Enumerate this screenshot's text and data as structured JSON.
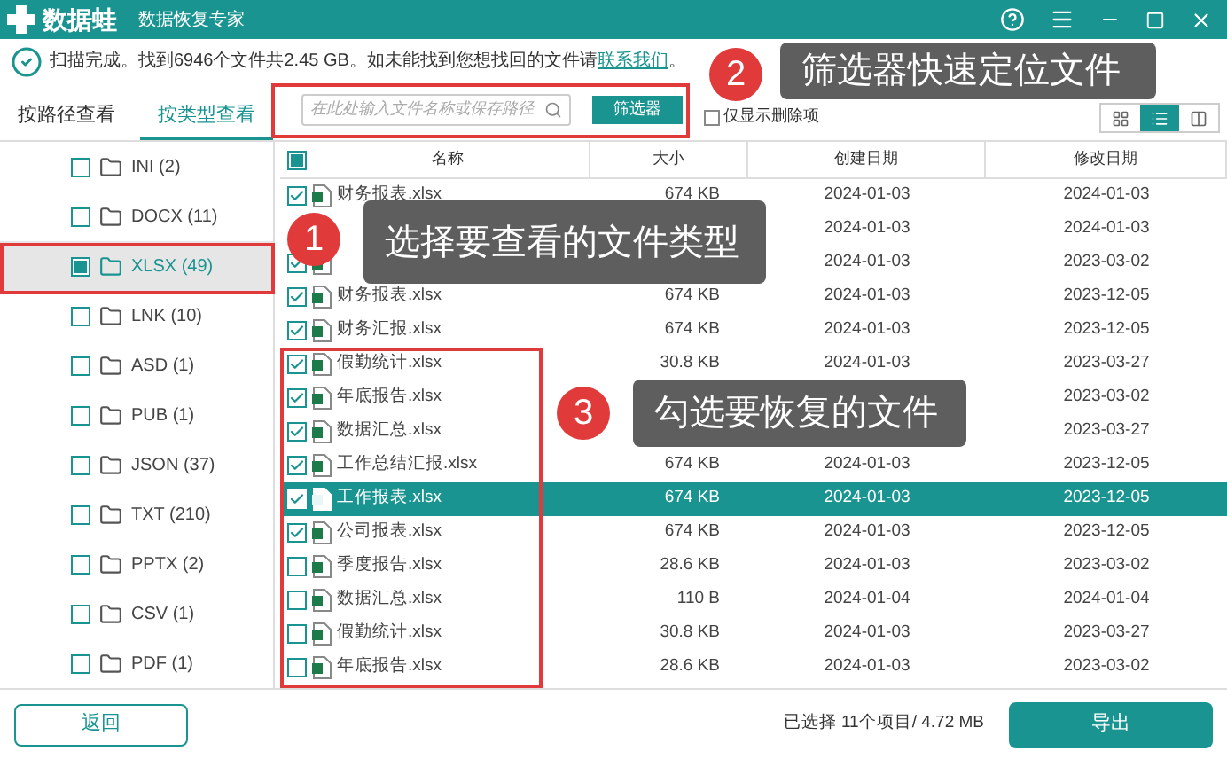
{
  "titlebar": {
    "app_name": "数据蛙",
    "subtitle": "数据恢复专家"
  },
  "status": {
    "message": "扫描完成。找到6946个文件共2.45 GB。如未能找到您想找回的文件请",
    "link": "联系我们",
    "end": "。"
  },
  "tabs": [
    {
      "label": "按路径查看",
      "selected": false
    },
    {
      "label": "按类型查看",
      "selected": true
    }
  ],
  "search": {
    "placeholder": "在此处输入文件名称或保存路径"
  },
  "filter_button": "筛选器",
  "deleted_only": {
    "label": "仅显示删除项",
    "checked": false
  },
  "view_modes": [
    {
      "kind": "grid",
      "selected": false
    },
    {
      "kind": "list",
      "selected": true
    },
    {
      "kind": "columns",
      "selected": false
    }
  ],
  "sidebar": {
    "items": [
      {
        "label": "INI (2)",
        "checked": false,
        "selected": false
      },
      {
        "label": "DOCX (11)",
        "checked": false,
        "selected": false
      },
      {
        "label": "XLSX (49)",
        "checked": true,
        "selected": true
      },
      {
        "label": "LNK (10)",
        "checked": false,
        "selected": false
      },
      {
        "label": "ASD (1)",
        "checked": false,
        "selected": false
      },
      {
        "label": "PUB (1)",
        "checked": false,
        "selected": false
      },
      {
        "label": "JSON (37)",
        "checked": false,
        "selected": false
      },
      {
        "label": "TXT (210)",
        "checked": false,
        "selected": false
      },
      {
        "label": "PPTX (2)",
        "checked": false,
        "selected": false
      },
      {
        "label": "CSV (1)",
        "checked": false,
        "selected": false
      },
      {
        "label": "PDF (1)",
        "checked": false,
        "selected": false
      }
    ]
  },
  "table": {
    "all_checked": true,
    "columns": [
      "名称",
      "大小",
      "创建日期",
      "修改日期"
    ],
    "rows": [
      {
        "name": "财务报表.xlsx",
        "size": "674 KB",
        "created": "2024-01-03",
        "modified": "2024-01-03",
        "checked": true,
        "selected": false
      },
      {
        "created": "2024-01-03",
        "modified": "2024-01-03",
        "selected": false
      },
      {
        "created": "2024-01-03",
        "modified": "2023-03-02",
        "checked": true,
        "selected": false
      },
      {
        "name": "财务报表.xlsx",
        "size": "674 KB",
        "created": "2024-01-03",
        "modified": "2023-12-05",
        "checked": true,
        "selected": false
      },
      {
        "name": "财务汇报.xlsx",
        "size": "674 KB",
        "created": "2024-01-03",
        "modified": "2023-12-05",
        "checked": true,
        "selected": false
      },
      {
        "name": "假勤统计.xlsx",
        "size": "30.8 KB",
        "created": "2024-01-03",
        "modified": "2023-03-27",
        "checked": true,
        "selected": false
      },
      {
        "name": "年底报告.xlsx",
        "modified": "2023-03-02",
        "checked": true,
        "selected": false
      },
      {
        "name": "数据汇总.xlsx",
        "modified": "2023-03-27",
        "checked": true,
        "selected": false
      },
      {
        "name": "工作总结汇报.xlsx",
        "size": "674 KB",
        "created": "2024-01-03",
        "modified": "2023-12-05",
        "checked": true,
        "selected": false
      },
      {
        "name": "工作报表.xlsx",
        "size": "674 KB",
        "created": "2024-01-03",
        "modified": "2023-12-05",
        "checked": true,
        "selected": true
      },
      {
        "name": "公司报表.xlsx",
        "size": "674 KB",
        "created": "2024-01-03",
        "modified": "2023-12-05",
        "checked": true,
        "selected": false
      },
      {
        "name": "季度报告.xlsx",
        "size": "28.6 KB",
        "created": "2024-01-03",
        "modified": "2023-03-02",
        "checked": false,
        "selected": false
      },
      {
        "name": "数据汇总.xlsx",
        "size": "110 B",
        "created": "2024-01-04",
        "modified": "2024-01-04",
        "checked": false,
        "selected": false
      },
      {
        "name": "假勤统计.xlsx",
        "size": "30.8 KB",
        "created": "2024-01-03",
        "modified": "2023-03-27",
        "checked": false,
        "selected": false
      },
      {
        "name": "年底报告.xlsx",
        "size": "28.6 KB",
        "created": "2024-01-03",
        "modified": "2023-03-02",
        "checked": false,
        "selected": false
      }
    ]
  },
  "footer": {
    "back_button": "返回",
    "selection": "已选择 11个项目/ 4.72 MB",
    "export_button": "导出"
  },
  "annotations": [
    {
      "number": "1",
      "text": "选择要查看的文件类型"
    },
    {
      "number": "2",
      "text": "筛选器快速定位文件"
    },
    {
      "number": "3",
      "text": "勾选要恢复的文件"
    }
  ]
}
